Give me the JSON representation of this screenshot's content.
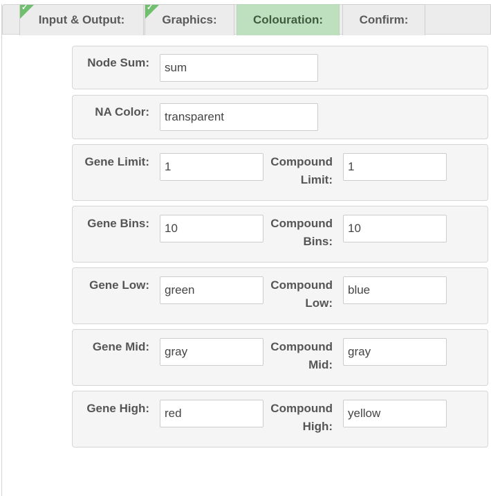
{
  "tabs": [
    {
      "label": "Input & Output:",
      "completed": true
    },
    {
      "label": "Graphics:",
      "completed": true
    },
    {
      "label": "Colouration:",
      "completed": false,
      "active": true
    },
    {
      "label": "Confirm:",
      "completed": false
    }
  ],
  "colors": {
    "active_tab": "#bfe0bf",
    "completed_marker": "#6fbf6f"
  },
  "fields": {
    "node_sum": {
      "label": "Node Sum:",
      "value": "sum"
    },
    "na_color": {
      "label": "NA Color:",
      "value": "transparent"
    },
    "gene_limit": {
      "label": "Gene Limit:",
      "value": "1"
    },
    "compound_limit": {
      "label_line1": "Compound",
      "label_line2": "Limit:",
      "value": "1"
    },
    "gene_bins": {
      "label": "Gene Bins:",
      "value": "10"
    },
    "compound_bins": {
      "label_line1": "Compound",
      "label_line2": "Bins:",
      "value": "10"
    },
    "gene_low": {
      "label": "Gene Low:",
      "value": "green"
    },
    "compound_low": {
      "label_line1": "Compound",
      "label_line2": "Low:",
      "value": "blue"
    },
    "gene_mid": {
      "label": "Gene Mid:",
      "value": "gray"
    },
    "compound_mid": {
      "label_line1": "Compound",
      "label_line2": "Mid:",
      "value": "gray"
    },
    "gene_high": {
      "label": "Gene High:",
      "value": "red"
    },
    "compound_high": {
      "label_line1": "Compound",
      "label_line2": "High:",
      "value": "yellow"
    }
  }
}
